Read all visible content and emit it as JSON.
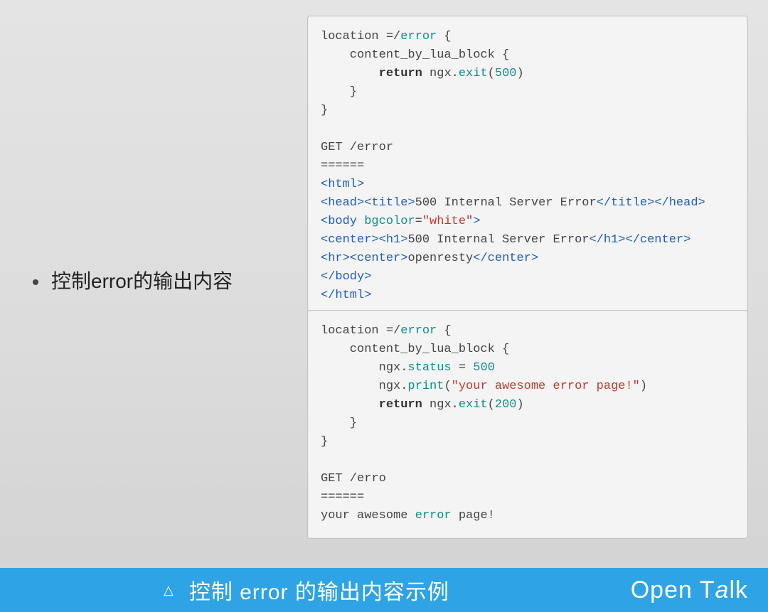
{
  "bullet_text_prefix": "控制",
  "bullet_text_mid": "error",
  "bullet_text_suffix": "的输出内容",
  "code_block_1": {
    "l1a": "location =/",
    "l1b": "error",
    "l1c": " {",
    "l2": "    content_by_lua_block {",
    "l3a": "        ",
    "l3b": "return",
    "l3c": " ngx.",
    "l3d": "exit",
    "l3e": "(",
    "l3f": "500",
    "l3g": ")",
    "l4": "    }",
    "l5": "}",
    "blank1": "",
    "l6": "GET /error",
    "l7": "======",
    "h_html_open": "<html>",
    "h_head_open": "<head>",
    "h_title_open": "<title>",
    "h_title_text": "500 Internal Server Error",
    "h_title_close": "</title>",
    "h_head_close": "</head>",
    "h_body_open": "<body ",
    "h_body_attr": "bgcolor",
    "h_body_eq": "=",
    "h_body_val": "\"white\"",
    "h_body_end": ">",
    "h_center_open": "<center>",
    "h_h1_open": "<h1>",
    "h_h1_text": "500 Internal Server Error",
    "h_h1_close": "</h1>",
    "h_center_close": "</center>",
    "h_hr": "<hr>",
    "h_center2_open": "<center>",
    "h_center2_text": "openresty",
    "h_center2_close": "</center>",
    "h_body_close": "</body>",
    "h_html_close": "</html>"
  },
  "code_block_2": {
    "l1a": "location =/",
    "l1b": "error",
    "l1c": " {",
    "l2": "    content_by_lua_block {",
    "l3a": "        ngx.",
    "l3b": "status",
    "l3c": " = ",
    "l3d": "500",
    "l4a": "        ngx.",
    "l4b": "print",
    "l4c": "(",
    "l4d": "\"your awesome error page!\"",
    "l4e": ")",
    "l5a": "        ",
    "l5b": "return",
    "l5c": " ngx.",
    "l5d": "exit",
    "l5e": "(",
    "l5f": "200",
    "l5g": ")",
    "l6": "    }",
    "l7": "}",
    "blank1": "",
    "l8": "GET /erro",
    "l9": "======",
    "l10a": "your awesome ",
    "l10b": "error",
    "l10c": " page!"
  },
  "footer": {
    "triangle": "△",
    "caption": "控制 error 的输出内容示例",
    "brand_open": "Open T",
    "brand_a": "a",
    "brand_lk": "lk"
  }
}
